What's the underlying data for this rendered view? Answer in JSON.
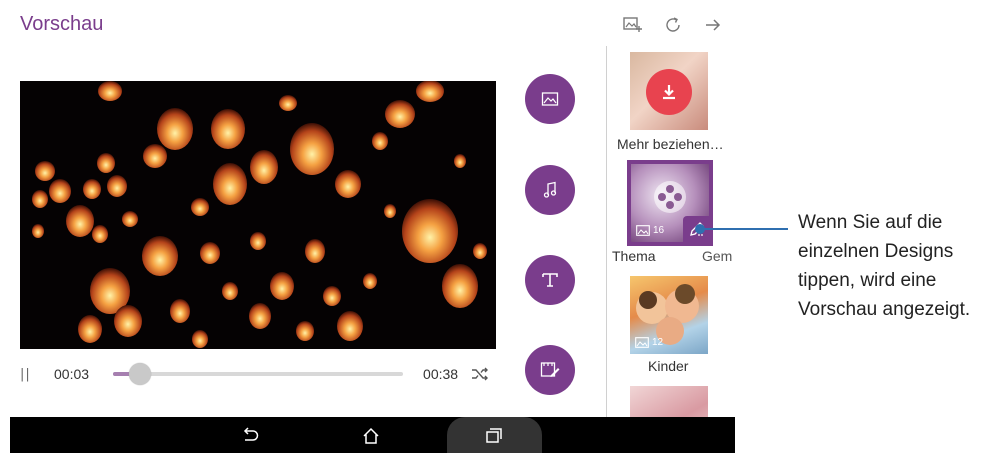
{
  "header": {
    "title": "Vorschau",
    "icons": [
      "add-photo-icon",
      "refresh-icon",
      "arrow-right-icon"
    ]
  },
  "player": {
    "current_time": "00:03",
    "total_time": "00:38",
    "progress": 0.08
  },
  "tools": [
    "image-icon",
    "music-icon",
    "text-icon",
    "edit-clip-icon"
  ],
  "themes": {
    "more_label": "Mehr beziehen…",
    "selected_count": "16",
    "selected_label": "Thema",
    "selected_label_right": "Gem",
    "kids_count": "12",
    "kids_label": "Kinder"
  },
  "navbar": [
    "back-icon",
    "home-icon",
    "recent-apps-icon"
  ],
  "callout": {
    "text": "Wenn Sie auf die einzelnen Designs tippen, wird eine Vorschau angezeigt."
  },
  "colors": {
    "accent": "#7a3d8c",
    "download": "#e8434f",
    "callout": "#2f6fb0"
  }
}
